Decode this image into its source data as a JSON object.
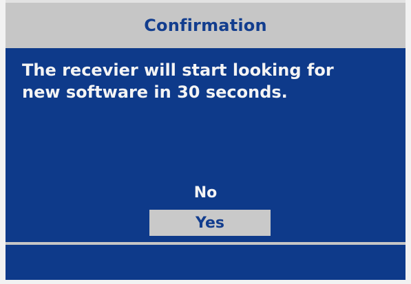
{
  "dialog": {
    "title": "Confirmation",
    "message": "The recevier will start looking for\nnew software in 30 seconds.",
    "options": [
      {
        "label": "No",
        "selected": false
      },
      {
        "label": "Yes",
        "selected": true
      }
    ]
  },
  "colors": {
    "background": "#0e3a8a",
    "title_bar": "#c6c6c6",
    "title_text": "#123d8e",
    "body_text": "#f4f4f4",
    "selection_highlight": "#c9c9c9"
  }
}
